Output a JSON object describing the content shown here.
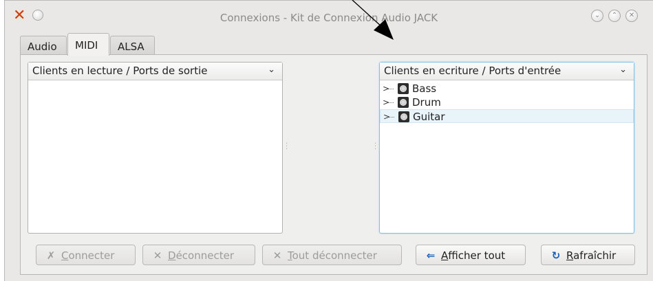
{
  "window": {
    "title": "Connexions - Kit de Connexion Audio JACK",
    "app_icon": "qjackctl-x-icon",
    "title_buttons": [
      "minimize-icon",
      "maximize-icon",
      "close-icon"
    ]
  },
  "tabs": [
    {
      "label": "Audio",
      "active": false
    },
    {
      "label": "MIDI",
      "active": true
    },
    {
      "label": "ALSA",
      "active": false
    }
  ],
  "left_panel": {
    "header": "Clients en lecture / Ports de sortie",
    "items": []
  },
  "right_panel": {
    "header": "Clients en ecriture / Ports d'entrée",
    "items": [
      {
        "label": "Bass",
        "selected": false
      },
      {
        "label": "Drum",
        "selected": false
      },
      {
        "label": "Guitar",
        "selected": true
      }
    ]
  },
  "buttons": {
    "connect": {
      "icon": "connect-icon",
      "accel": "C",
      "rest": "onnecter",
      "enabled": false
    },
    "disconnect": {
      "icon": "disconnect-icon",
      "accel": "D",
      "rest": "éconnecter",
      "enabled": false
    },
    "disconnect_all": {
      "icon": "disconnect-all-icon",
      "accel": "T",
      "rest": "out déconnecter",
      "enabled": false
    },
    "show_all": {
      "icon": "expand-icon",
      "pre": "",
      "accel": "A",
      "rest": "fficher tout",
      "enabled": true
    },
    "refresh": {
      "icon": "refresh-icon",
      "accel": "R",
      "rest": "afraîchir",
      "enabled": true
    }
  },
  "colors": {
    "accent_focus": "#7ec3e6",
    "icon_blue": "#1b5fb5",
    "app_icon_red": "#d63b00"
  }
}
